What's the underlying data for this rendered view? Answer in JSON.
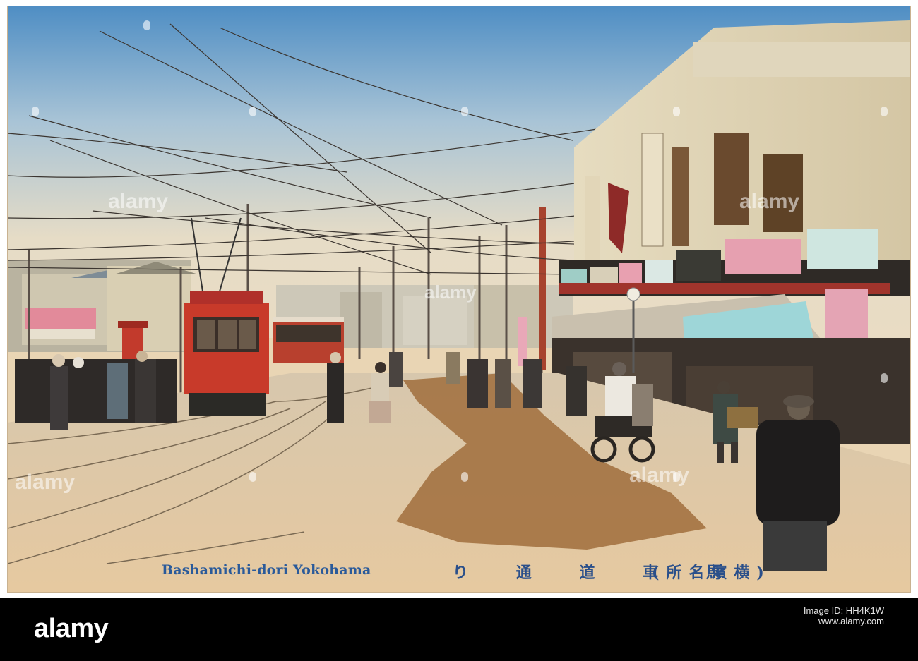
{
  "caption": {
    "english": "Bashamichi-dori Yokohama",
    "japanese_main": "り 通 道 車 馬",
    "japanese_paren": "(所名濱横)"
  },
  "watermark": {
    "text": "alamy"
  },
  "footer": {
    "logo": "alamy",
    "image_id_label": "Image ID: HH4K1W",
    "image_id": "",
    "url": "www.alamy.com"
  },
  "colors": {
    "sky_top": "#4f8ec4",
    "sky_bottom": "#e6dcc6",
    "tram_red": "#c83a2a",
    "road": "#d9c3a0",
    "caption_blue": "#2a5a9a",
    "footer_bg": "#000000"
  }
}
